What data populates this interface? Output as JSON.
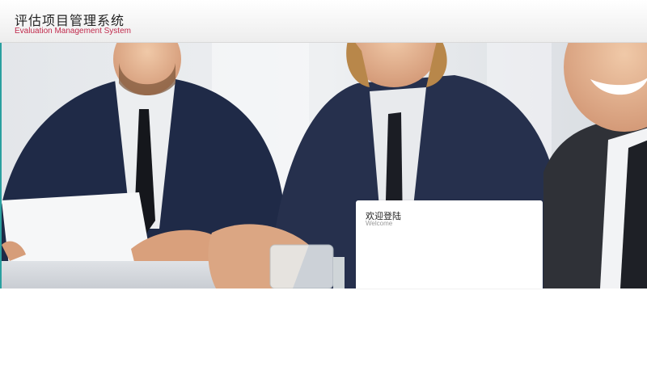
{
  "header": {
    "title": "评估项目管理系统",
    "subtitle": "Evaluation Management System"
  },
  "hero": {
    "image": "business-meeting-photo"
  },
  "login": {
    "title": "欢迎登陆",
    "subtitle": "Welcome"
  },
  "colors": {
    "subtitle": "#c0294b",
    "accent_edge": "#2aa0a0",
    "suit_navy": "#26304d"
  }
}
